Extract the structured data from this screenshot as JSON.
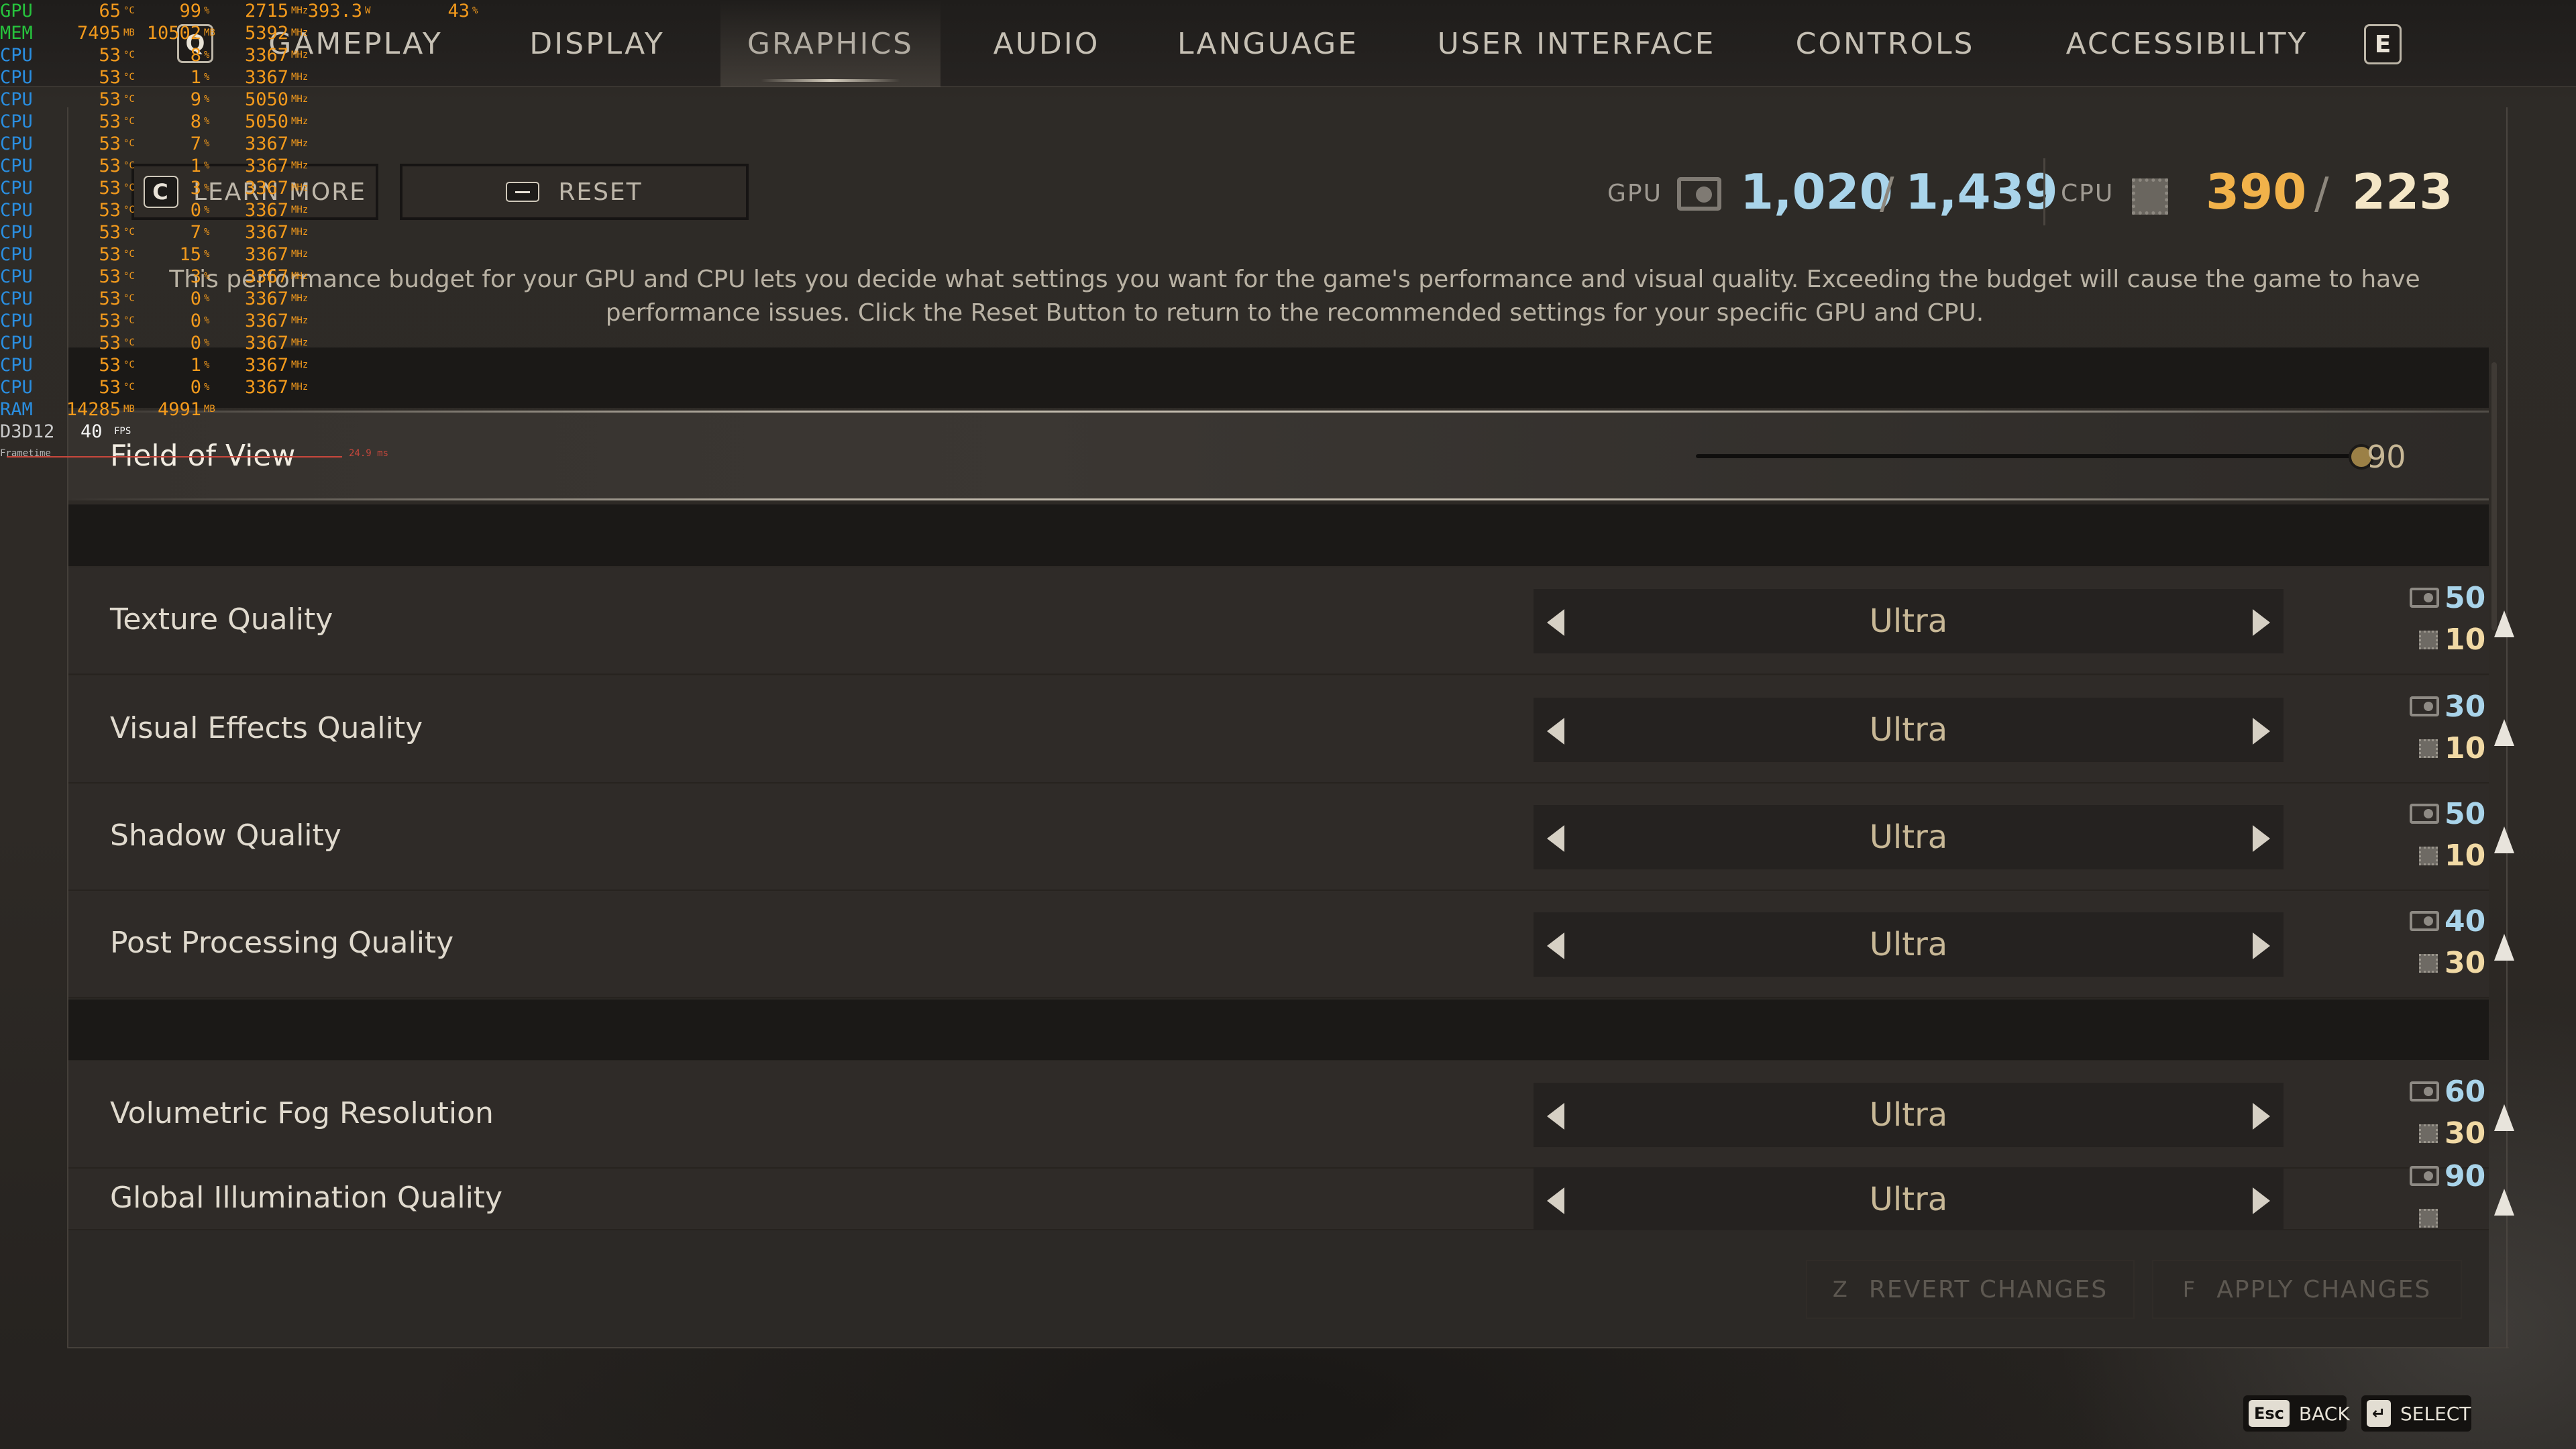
{
  "nav": {
    "tabs": [
      {
        "label": "GAMEPLAY"
      },
      {
        "label": "DISPLAY"
      },
      {
        "label": "GRAPHICS",
        "active": true
      },
      {
        "label": "AUDIO"
      },
      {
        "label": "LANGUAGE"
      },
      {
        "label": "USER INTERFACE"
      },
      {
        "label": "CONTROLS"
      },
      {
        "label": "ACCESSIBILITY"
      }
    ],
    "prev_key": "Q",
    "next_key": "E"
  },
  "toolbar": {
    "learn_more_key": "C",
    "learn_more_label": "LEARN MORE",
    "reset_label": "RESET",
    "reset_icon": "enter-key-icon"
  },
  "budget": {
    "gpu_label": "GPU",
    "gpu_used": "1,020",
    "gpu_total": "1,439",
    "cpu_label": "CPU",
    "cpu_used": "390",
    "cpu_total": "223",
    "separator": "/",
    "gpu_color": "#a9d4ea",
    "cpu_used_color": "#f1b24a",
    "cpu_total_color": "#f4e6c6",
    "description": "This performance budget for your GPU and CPU lets you decide what settings you want for the game's performance and visual quality. Exceeding the budget will cause the game to have performance issues. Click the Reset Button to return to the recommended settings for your specific GPU and CPU."
  },
  "field_of_view": {
    "label": "Field of View",
    "value": "90",
    "slider_fraction": 1.0
  },
  "settings": [
    {
      "label": "Texture Quality",
      "value": "Ultra",
      "gpu_cost": "50",
      "cpu_cost": "10"
    },
    {
      "label": "Visual Effects Quality",
      "value": "Ultra",
      "gpu_cost": "30",
      "cpu_cost": "10"
    },
    {
      "label": "Shadow Quality",
      "value": "Ultra",
      "gpu_cost": "50",
      "cpu_cost": "10"
    },
    {
      "label": "Post Processing Quality",
      "value": "Ultra",
      "gpu_cost": "40",
      "cpu_cost": "30"
    },
    {
      "label": "Volumetric Fog Resolution",
      "value": "Ultra",
      "gpu_cost": "60",
      "cpu_cost": "30"
    },
    {
      "label": "Global Illumination Quality",
      "value": "Ultra",
      "gpu_cost": "90",
      "cpu_cost": ""
    }
  ],
  "actions": {
    "revert_key": "Z",
    "revert_label": "REVERT CHANGES",
    "apply_key": "F",
    "apply_label": "APPLY CHANGES"
  },
  "hints": {
    "back_key": "Esc",
    "back_label": "BACK",
    "select_label": "SELECT"
  },
  "osd": {
    "rows": [
      {
        "name": "GPU",
        "a": "65",
        "ua": "°C",
        "b": "99",
        "ub": "%",
        "c": "2715",
        "uc": "MHz",
        "d": "393.3",
        "ud": "W",
        "e": "43",
        "ue": "%"
      },
      {
        "name": "MEM",
        "a": "7495",
        "ua": "MB",
        "b": "10502",
        "ub": "MB",
        "c": "5392",
        "uc": "MHz"
      },
      {
        "name": "CPU",
        "a": "53",
        "ua": "°C",
        "b": "8",
        "ub": "%",
        "c": "3367",
        "uc": "MHz"
      },
      {
        "name": "CPU",
        "a": "53",
        "ua": "°C",
        "b": "1",
        "ub": "%",
        "c": "3367",
        "uc": "MHz"
      },
      {
        "name": "CPU",
        "a": "53",
        "ua": "°C",
        "b": "9",
        "ub": "%",
        "c": "5050",
        "uc": "MHz"
      },
      {
        "name": "CPU",
        "a": "53",
        "ua": "°C",
        "b": "8",
        "ub": "%",
        "c": "5050",
        "uc": "MHz"
      },
      {
        "name": "CPU",
        "a": "53",
        "ua": "°C",
        "b": "7",
        "ub": "%",
        "c": "3367",
        "uc": "MHz"
      },
      {
        "name": "CPU",
        "a": "53",
        "ua": "°C",
        "b": "1",
        "ub": "%",
        "c": "3367",
        "uc": "MHz"
      },
      {
        "name": "CPU",
        "a": "53",
        "ua": "°C",
        "b": "3",
        "ub": "%",
        "c": "3367",
        "uc": "MHz"
      },
      {
        "name": "CPU",
        "a": "53",
        "ua": "°C",
        "b": "0",
        "ub": "%",
        "c": "3367",
        "uc": "MHz"
      },
      {
        "name": "CPU",
        "a": "53",
        "ua": "°C",
        "b": "7",
        "ub": "%",
        "c": "3367",
        "uc": "MHz"
      },
      {
        "name": "CPU",
        "a": "53",
        "ua": "°C",
        "b": "15",
        "ub": "%",
        "c": "3367",
        "uc": "MHz"
      },
      {
        "name": "CPU",
        "a": "53",
        "ua": "°C",
        "b": "3",
        "ub": "%",
        "c": "3367",
        "uc": "MHz"
      },
      {
        "name": "CPU",
        "a": "53",
        "ua": "°C",
        "b": "0",
        "ub": "%",
        "c": "3367",
        "uc": "MHz"
      },
      {
        "name": "CPU",
        "a": "53",
        "ua": "°C",
        "b": "0",
        "ub": "%",
        "c": "3367",
        "uc": "MHz"
      },
      {
        "name": "CPU",
        "a": "53",
        "ua": "°C",
        "b": "0",
        "ub": "%",
        "c": "3367",
        "uc": "MHz"
      },
      {
        "name": "CPU",
        "a": "53",
        "ua": "°C",
        "b": "1",
        "ub": "%",
        "c": "3367",
        "uc": "MHz"
      },
      {
        "name": "CPU",
        "a": "53",
        "ua": "°C",
        "b": "0",
        "ub": "%",
        "c": "3367",
        "uc": "MHz"
      },
      {
        "name": "RAM",
        "a": "14285",
        "ua": "MB",
        "b": "4991",
        "ub": "MB"
      }
    ],
    "api_label": "D3D12",
    "fps": "40",
    "fps_unit": "FPS",
    "frametime_label": "Frametime",
    "frametime_value": "24.9 ms"
  }
}
